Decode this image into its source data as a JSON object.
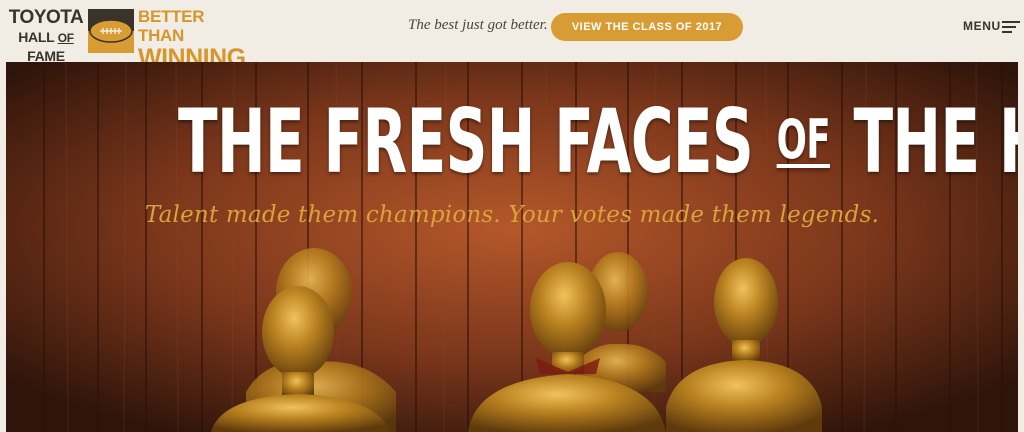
{
  "header": {
    "logo": {
      "line1": "TOYOTA",
      "line2_a": "HALL",
      "line2_of": "OF",
      "line2_b": "FAME",
      "tag1": "BETTER THAN",
      "tag2": "WINNING"
    },
    "tagline": "The best just got better.",
    "cta_label": "VIEW THE CLASS OF 2017",
    "menu_label": "MENU"
  },
  "hero": {
    "title_pre": "THE FRESH FACES",
    "title_of": "OF",
    "title_post": "THE HALL",
    "subtitle": "Talent made them champions. Your votes made them legends."
  },
  "colors": {
    "accent": "#d79c33",
    "dark_text": "#3b322a",
    "background": "#f1ede4",
    "wood": "#5a2c18"
  },
  "icons": [
    "football-logo-icon",
    "hamburger-menu-icon"
  ]
}
